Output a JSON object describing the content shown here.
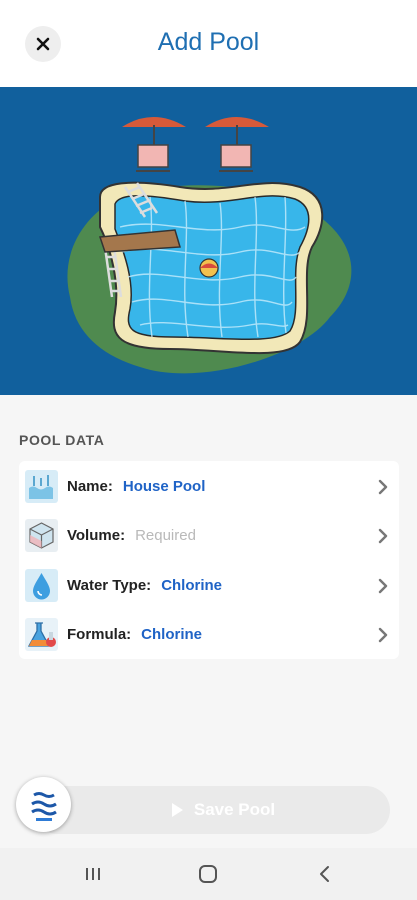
{
  "header": {
    "title": "Add Pool",
    "close_icon": "close-icon"
  },
  "hero": {
    "background": "#11609d",
    "image": "pool-illustration"
  },
  "pool_data": {
    "section_label": "POOL DATA",
    "rows": [
      {
        "label": "Name:",
        "value": "House Pool",
        "icon": "water-level-icon",
        "value_state": "filled"
      },
      {
        "label": "Volume:",
        "value": "Required",
        "icon": "cube-icon",
        "value_state": "placeholder"
      },
      {
        "label": "Water Type:",
        "value": "Chlorine",
        "icon": "water-drop-icon",
        "value_state": "filled"
      },
      {
        "label": "Formula:",
        "value": "Chlorine",
        "icon": "flask-icon",
        "value_state": "filled"
      }
    ]
  },
  "footer": {
    "save_label": "Save Pool",
    "save_enabled": false
  },
  "system_nav": {
    "buttons": [
      "recent-apps-icon",
      "home-icon",
      "back-icon"
    ]
  },
  "colors": {
    "accent": "#1f63c6",
    "title": "#1f6fb2",
    "placeholder": "#b9b9b9"
  }
}
